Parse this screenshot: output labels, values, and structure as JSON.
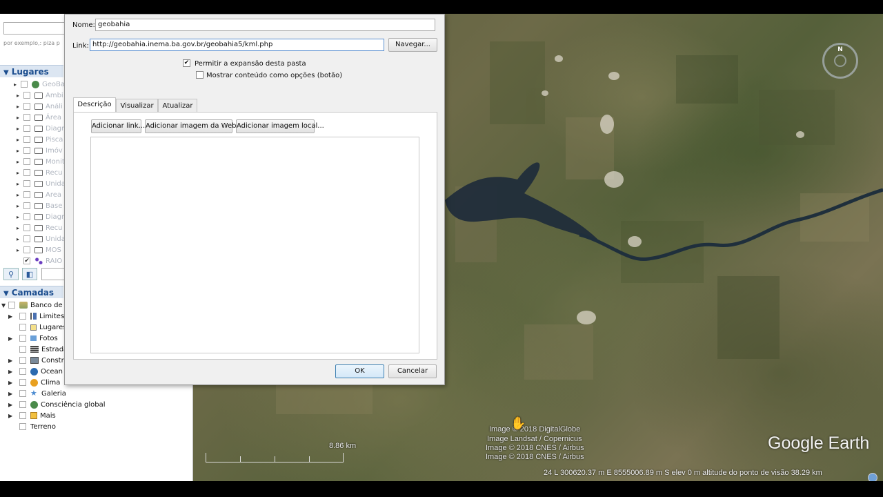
{
  "left_panel": {
    "search_hint": "por exemplo,: piza p",
    "places": {
      "header": "Lugares",
      "items": [
        {
          "label": "GeoBah",
          "icon": "globe-icon"
        },
        {
          "label": "Ambi",
          "icon": "folder-icon"
        },
        {
          "label": "Análi",
          "icon": "folder-icon"
        },
        {
          "label": "Área",
          "icon": "folder-icon"
        },
        {
          "label": "Diagr",
          "icon": "folder-icon"
        },
        {
          "label": "Pisca",
          "icon": "folder-icon"
        },
        {
          "label": "Imóv",
          "icon": "folder-icon"
        },
        {
          "label": "Monit",
          "icon": "folder-icon"
        },
        {
          "label": "Recu",
          "icon": "folder-icon"
        },
        {
          "label": "Unida",
          "icon": "folder-icon"
        },
        {
          "label": "Area",
          "icon": "folder-icon"
        },
        {
          "label": "Base",
          "icon": "folder-icon"
        },
        {
          "label": "Diagr",
          "icon": "folder-icon"
        },
        {
          "label": "Recu",
          "icon": "folder-icon"
        },
        {
          "label": "Unida",
          "icon": "folder-icon"
        },
        {
          "label": "MOS",
          "icon": "folder-icon"
        },
        {
          "label": "RAIO R",
          "icon": "network-icon"
        }
      ]
    },
    "layers": {
      "header": "Camadas",
      "items": [
        {
          "label": "Banco de",
          "icon": "layers-icon"
        },
        {
          "label": "Limites",
          "icon": "flag-icon"
        },
        {
          "label": "Lugares",
          "icon": "places-icon"
        },
        {
          "label": "Fotos",
          "icon": "photo-icon"
        },
        {
          "label": "Estrada",
          "icon": "road-icon"
        },
        {
          "label": "Constru",
          "icon": "building-icon"
        },
        {
          "label": "Ocean",
          "icon": "ocean-icon"
        },
        {
          "label": "Clima",
          "icon": "sun-icon"
        },
        {
          "label": "Galeria",
          "icon": "star-icon"
        },
        {
          "label": "Consciência global",
          "icon": "globe-icon"
        },
        {
          "label": "Mais",
          "icon": "more-icon"
        },
        {
          "label": "Terreno",
          "icon": ""
        }
      ]
    }
  },
  "dialog": {
    "name_label": "Nome:",
    "name_value": "geobahia",
    "link_label": "Link:",
    "link_value": "http://geobahia.inema.ba.gov.br/geobahia5/kml.php",
    "browse_button": "Navegar...",
    "allow_expand_label": "Permitir a expansão desta pasta",
    "allow_expand_checked": "✔",
    "show_as_options_label": "Mostrar conteúdo como opções (botão)",
    "tabs": [
      "Descrição",
      "Visualizar",
      "Atualizar"
    ],
    "add_link_button": "Adicionar link...",
    "add_web_image_button": "Adicionar imagem da Web...",
    "add_local_image_button": "Adicionar imagem local...",
    "ok_button": "OK",
    "cancel_button": "Cancelar"
  },
  "map": {
    "compass_north": "N",
    "scale_label": "8.86 km",
    "credits": [
      "Image © 2018 DigitalGlobe",
      "Image Landsat / Copernicus",
      "Image © 2018 CNES / Airbus",
      "Image © 2018 CNES / Airbus"
    ],
    "logo": "Google Earth",
    "status": "24 L 300620.37 m E 8555006.89 m S   elev     0 m      altitude do ponto de visão  38.29 km"
  }
}
